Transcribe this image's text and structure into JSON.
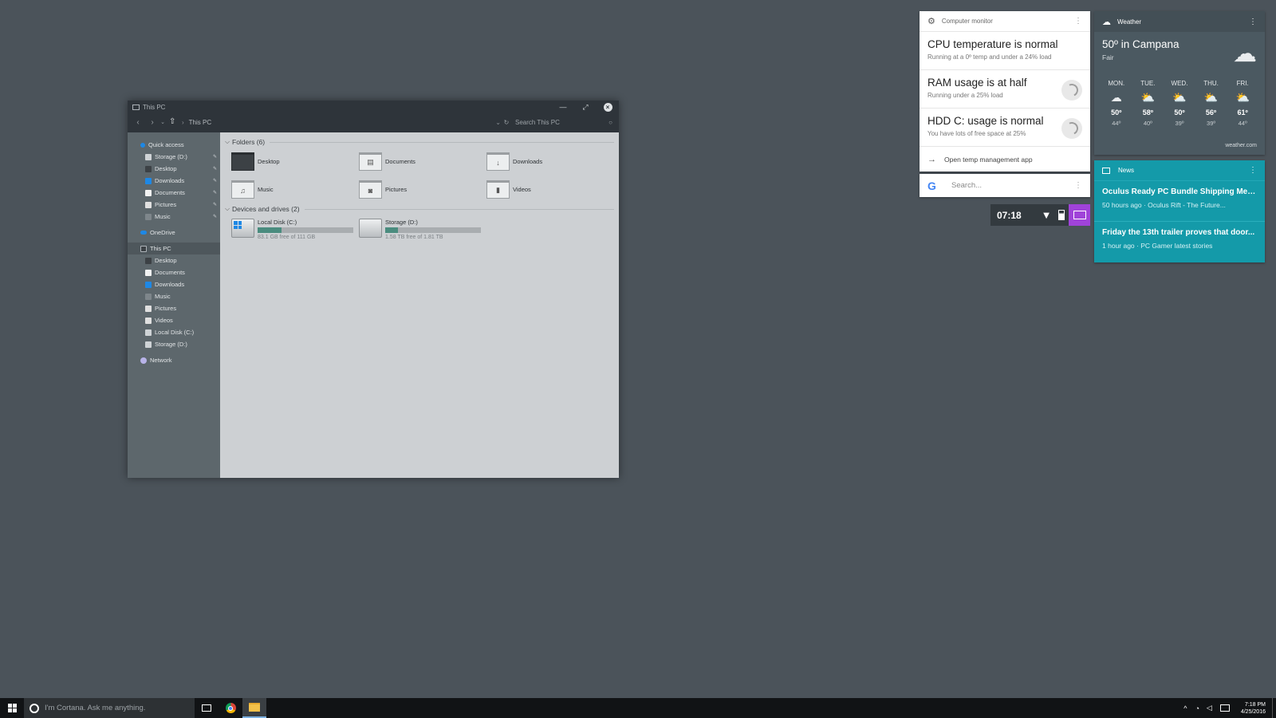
{
  "explorer": {
    "title": "This PC",
    "breadcrumb": "This PC",
    "search_placeholder": "Search This PC",
    "nav": {
      "quick_access": "Quick access",
      "quick_items": [
        {
          "label": "Storage (D:)",
          "icon": "drive-icon",
          "color": "#cfd3d6"
        },
        {
          "label": "Desktop",
          "icon": "desktop-icon",
          "color": "#3c4145"
        },
        {
          "label": "Downloads",
          "icon": "downloads-icon",
          "color": "#1e88e5"
        },
        {
          "label": "Documents",
          "icon": "documents-icon",
          "color": "#f2f2f2"
        },
        {
          "label": "Pictures",
          "icon": "pictures-icon",
          "color": "#e0e0e0"
        },
        {
          "label": "Music",
          "icon": "music-icon",
          "color": "#7e868b"
        }
      ],
      "onedrive": "OneDrive",
      "this_pc": "This PC",
      "pc_items": [
        {
          "label": "Desktop",
          "icon": "desktop-icon",
          "color": "#3c4145"
        },
        {
          "label": "Documents",
          "icon": "documents-icon",
          "color": "#f2f2f2"
        },
        {
          "label": "Downloads",
          "icon": "downloads-icon",
          "color": "#1e88e5"
        },
        {
          "label": "Music",
          "icon": "music-icon",
          "color": "#7e868b"
        },
        {
          "label": "Pictures",
          "icon": "pictures-icon",
          "color": "#e0e0e0"
        },
        {
          "label": "Videos",
          "icon": "videos-icon",
          "color": "#e0e0e0"
        },
        {
          "label": "Local Disk (C:)",
          "icon": "drive-icon",
          "color": "#cfd3d6"
        },
        {
          "label": "Storage (D:)",
          "icon": "drive-icon",
          "color": "#cfd3d6"
        }
      ],
      "network": "Network"
    },
    "folders_header": "Folders (6)",
    "folders": [
      {
        "label": "Desktop",
        "icon": "desktop-folder-icon"
      },
      {
        "label": "Documents",
        "icon": "documents-folder-icon"
      },
      {
        "label": "Downloads",
        "icon": "downloads-folder-icon"
      },
      {
        "label": "Music",
        "icon": "music-folder-icon"
      },
      {
        "label": "Pictures",
        "icon": "pictures-folder-icon"
      },
      {
        "label": "Videos",
        "icon": "videos-folder-icon"
      }
    ],
    "drives_header": "Devices and drives (2)",
    "drives": [
      {
        "label": "Local Disk (C:)",
        "free": "83.1 GB free of 111 GB",
        "used_fraction": 0.25
      },
      {
        "label": "Storage (D:)",
        "free": "1.58 TB free of 1.81 TB",
        "used_fraction": 0.13
      }
    ]
  },
  "monitor": {
    "title": "Computer monitor",
    "rows": [
      {
        "heading": "CPU temperature is normal",
        "sub": "Running at a 0º temp and under a 24% load"
      },
      {
        "heading": "RAM usage is at half",
        "sub": "Running under a 25% load"
      },
      {
        "heading": "HDD C: usage is normal",
        "sub": "You have lots of free space at 25%"
      }
    ],
    "link": "Open temp management app"
  },
  "google": {
    "placeholder": "Search..."
  },
  "status": {
    "time": "07:18"
  },
  "weather": {
    "title": "Weather",
    "city": "50º in Campana",
    "condition": "Fair",
    "days": [
      {
        "day": "MON.",
        "hi": "50º",
        "lo": "44º",
        "icon": "cloudy-icon"
      },
      {
        "day": "TUE.",
        "hi": "58º",
        "lo": "40º",
        "icon": "partly-sunny-icon"
      },
      {
        "day": "WED.",
        "hi": "50º",
        "lo": "39º",
        "icon": "mostly-cloudy-icon"
      },
      {
        "day": "THU.",
        "hi": "56º",
        "lo": "39º",
        "icon": "partly-sunny-icon"
      },
      {
        "day": "FRI.",
        "hi": "61º",
        "lo": "44º",
        "icon": "partly-sunny-icon"
      }
    ],
    "source": "weather.com"
  },
  "news": {
    "title": "News",
    "stories": [
      {
        "headline": "Oculus Ready PC Bundle Shipping Meg...",
        "meta": "50 hours ago · Oculus Rift - The Future..."
      },
      {
        "headline": "Friday the 13th trailer proves that door...",
        "meta": "1 hour ago · PC Gamer latest stories"
      }
    ]
  },
  "taskbar": {
    "cortana": "I'm Cortana. Ask me anything.",
    "time": "7:18 PM",
    "date": "4/25/2016"
  }
}
